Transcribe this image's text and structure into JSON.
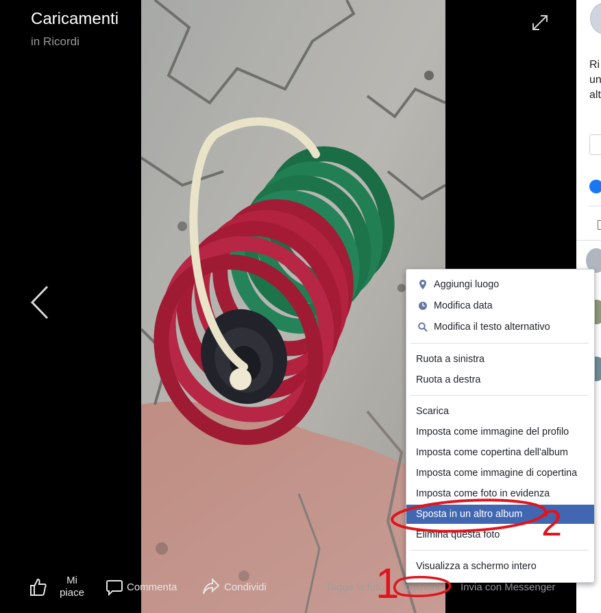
{
  "viewer": {
    "title": "Caricamenti",
    "album": "in Ricordi",
    "icons": {
      "expand": "expand-icon",
      "prev": "chevron-left-icon"
    }
  },
  "actions": {
    "like": "Mi piace",
    "comment": "Commenta",
    "share": "Condividi",
    "tag": "Tagga la foto",
    "options": "Opzioni",
    "messenger": "Invia con Messenger"
  },
  "menu": {
    "group1": [
      {
        "label": "Aggiungi luogo",
        "icon": "map-pin-icon"
      },
      {
        "label": "Modifica data",
        "icon": "clock-icon"
      },
      {
        "label": "Modifica il testo alternativo",
        "icon": "search-icon"
      }
    ],
    "group2": [
      {
        "label": "Ruota a sinistra"
      },
      {
        "label": "Ruota a destra"
      }
    ],
    "group3": [
      {
        "label": "Scarica"
      },
      {
        "label": "Imposta come immagine del profilo"
      },
      {
        "label": "Imposta come copertina dell'album"
      },
      {
        "label": "Imposta come immagine di copertina"
      },
      {
        "label": "Imposta come foto in evidenza"
      },
      {
        "label": "Sposta in un altro album",
        "highlighted": true
      },
      {
        "label": "Elimina questa foto"
      }
    ],
    "group4": [
      {
        "label": "Visualizza a schermo intero"
      }
    ]
  },
  "side": {
    "text_lines": [
      "Ri",
      "un",
      "alt"
    ]
  },
  "annotations": {
    "mark1": "1",
    "mark2": "2",
    "color": "#e0141e"
  },
  "colors": {
    "menu_highlight": "#4267b2",
    "like_blue": "#1877f2"
  }
}
